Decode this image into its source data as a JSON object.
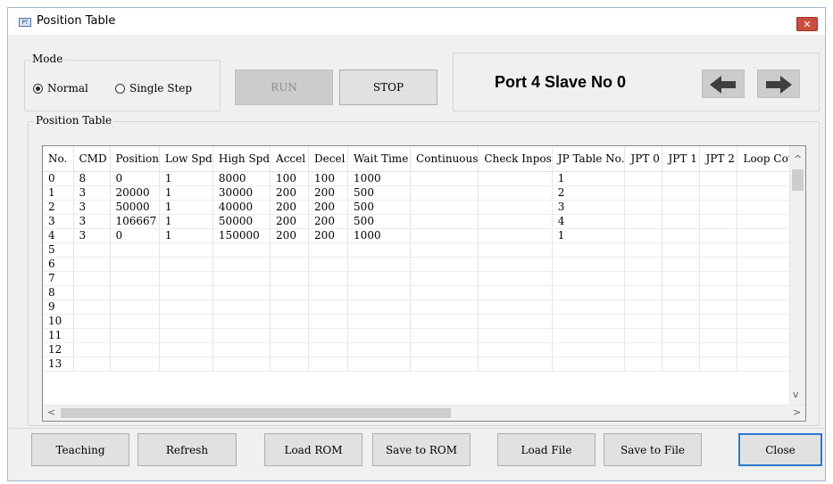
{
  "window": {
    "title": "Position Table",
    "app_icon": "PT",
    "close_glyph": "✕"
  },
  "mode": {
    "label": "Mode",
    "options": [
      {
        "label": "Normal",
        "selected": true
      },
      {
        "label": "Single Step",
        "selected": false
      }
    ],
    "run_label": "RUN",
    "stop_label": "STOP"
  },
  "port": {
    "text": "Port 4 Slave No 0",
    "prev_icon": "arrow-left-icon",
    "next_icon": "arrow-right-icon"
  },
  "table": {
    "label": "Position Table",
    "columns": [
      "No.",
      "CMD",
      "Position",
      "Low Spd",
      "High Spd",
      "Accel",
      "Decel",
      "Wait Time",
      "Continuous",
      "Check Inpos",
      "JP Table No.",
      "JPT 0",
      "JPT 1",
      "JPT 2",
      "Loop Coun"
    ],
    "rows": [
      [
        "0",
        "8",
        "0",
        "1",
        "8000",
        "100",
        "100",
        "1000",
        "",
        "",
        "1",
        "",
        "",
        "",
        ""
      ],
      [
        "1",
        "3",
        "20000",
        "1",
        "30000",
        "200",
        "200",
        "500",
        "",
        "",
        "2",
        "",
        "",
        "",
        ""
      ],
      [
        "2",
        "3",
        "50000",
        "1",
        "40000",
        "200",
        "200",
        "500",
        "",
        "",
        "3",
        "",
        "",
        "",
        ""
      ],
      [
        "3",
        "3",
        "106667",
        "1",
        "50000",
        "200",
        "200",
        "500",
        "",
        "",
        "4",
        "",
        "",
        "",
        ""
      ],
      [
        "4",
        "3",
        "0",
        "1",
        "150000",
        "200",
        "200",
        "1000",
        "",
        "",
        "1",
        "",
        "",
        "",
        ""
      ],
      [
        "5",
        "",
        "",
        "",
        "",
        "",
        "",
        "",
        "",
        "",
        "",
        "",
        "",
        "",
        ""
      ],
      [
        "6",
        "",
        "",
        "",
        "",
        "",
        "",
        "",
        "",
        "",
        "",
        "",
        "",
        "",
        ""
      ],
      [
        "7",
        "",
        "",
        "",
        "",
        "",
        "",
        "",
        "",
        "",
        "",
        "",
        "",
        "",
        ""
      ],
      [
        "8",
        "",
        "",
        "",
        "",
        "",
        "",
        "",
        "",
        "",
        "",
        "",
        "",
        "",
        ""
      ],
      [
        "9",
        "",
        "",
        "",
        "",
        "",
        "",
        "",
        "",
        "",
        "",
        "",
        "",
        "",
        ""
      ],
      [
        "10",
        "",
        "",
        "",
        "",
        "",
        "",
        "",
        "",
        "",
        "",
        "",
        "",
        "",
        ""
      ],
      [
        "11",
        "",
        "",
        "",
        "",
        "",
        "",
        "",
        "",
        "",
        "",
        "",
        "",
        "",
        ""
      ],
      [
        "12",
        "",
        "",
        "",
        "",
        "",
        "",
        "",
        "",
        "",
        "",
        "",
        "",
        "",
        ""
      ],
      [
        "13",
        "",
        "",
        "",
        "",
        "",
        "",
        "",
        "",
        "",
        "",
        "",
        "",
        "",
        ""
      ]
    ]
  },
  "buttons": {
    "teaching": "Teaching",
    "refresh": "Refresh",
    "load_rom": "Load ROM",
    "save_rom": "Save to ROM",
    "load_file": "Load File",
    "save_file": "Save to File",
    "close": "Close"
  }
}
